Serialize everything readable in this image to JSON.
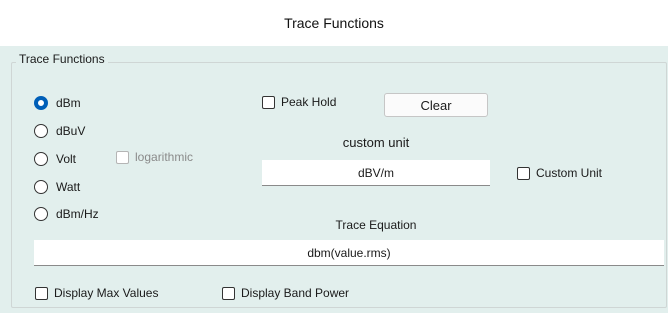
{
  "window": {
    "title": "Trace Functions"
  },
  "group": {
    "legend": "Trace Functions"
  },
  "units": {
    "options": [
      "dBm",
      "dBuV",
      "Volt",
      "Watt",
      "dBm/Hz"
    ],
    "selected": "dBm"
  },
  "logarithmic": {
    "label": "logarithmic",
    "checked": false,
    "enabled": false
  },
  "peak_hold": {
    "label": "Peak Hold",
    "checked": false
  },
  "clear_button": {
    "label": "Clear"
  },
  "custom_unit": {
    "heading": "custom unit",
    "value": "dBV/m"
  },
  "custom_unit_checkbox": {
    "label": "Custom Unit",
    "checked": false
  },
  "trace_equation": {
    "heading": "Trace Equation",
    "value": "dbm(value.rms)"
  },
  "display_max_values": {
    "label": "Display Max Values",
    "checked": false
  },
  "display_band_power": {
    "label": "Display Band Power",
    "checked": false
  },
  "colors": {
    "panel_bg": "#e2efed",
    "radio_selected": "#005fb8"
  }
}
